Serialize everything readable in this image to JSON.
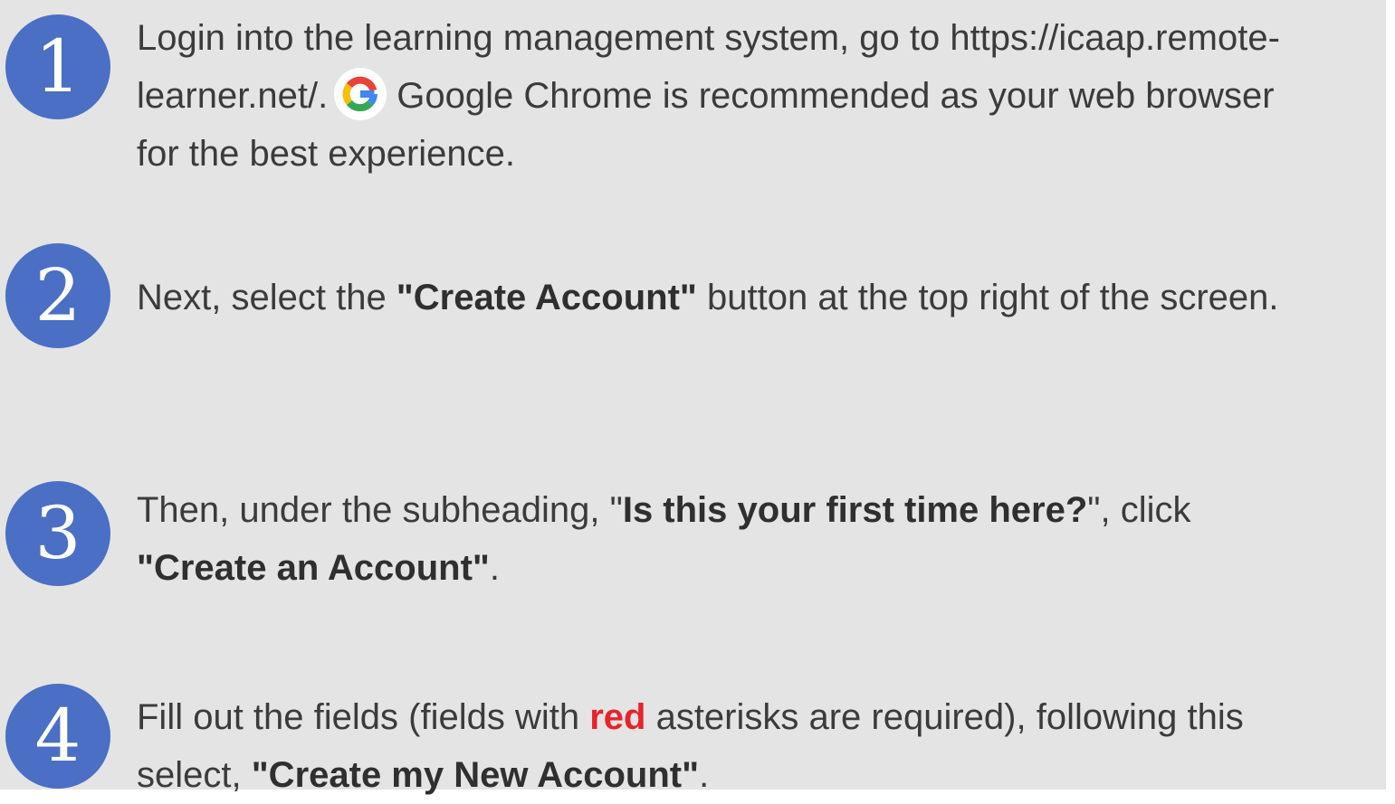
{
  "steps": [
    {
      "number": "1",
      "line1": "Login into the learning management system, go to https://icaap.remote-",
      "line2_pre": "learner.net/.",
      "line2_post": "Google Chrome is recommended as your web browser",
      "line3": "for the best experience.",
      "icon": "google-g-icon"
    },
    {
      "number": "2",
      "pre": "Next, select the ",
      "bold": "\"Create Account\"",
      "post": " button at the top right of the screen."
    },
    {
      "number": "3",
      "pre": "Then, under the subheading, \"",
      "bold": "Is this your first time here?",
      "mid": "\", click",
      "bold2": "\"Create an Account\"",
      "post": "."
    },
    {
      "number": "4",
      "pre": " Fill out the fields (fields with ",
      "red": "red",
      "mid": " asterisks are required), following this",
      "line2_pre": "select, ",
      "bold": "\"Create my New Account\"",
      "post": "."
    }
  ],
  "colors": {
    "background": "#e4e4e4",
    "badge": "#4a6fc4",
    "text": "#3b3b3b",
    "accent_red": "#e8232b"
  }
}
